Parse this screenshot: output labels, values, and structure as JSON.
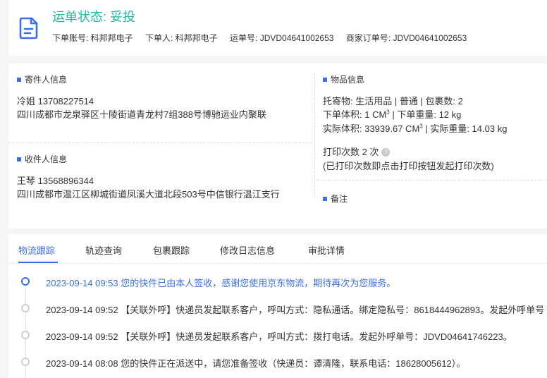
{
  "header": {
    "status_title": "运单状态: 妥投",
    "account": "下单账号: 科邦邦电子",
    "orderer": "下单人: 科邦邦电子",
    "waybill": "运单号: JDVD04641002653",
    "merchant_order": "商家订单号: JDVD04641002653"
  },
  "sender": {
    "title": "寄件人信息",
    "name_phone": "冷姐   13708227514",
    "address": "四川成都市龙泉驿区十陵街道青龙村7组388号博驰运业内聚联"
  },
  "receiver": {
    "title": "收件人信息",
    "name_phone": "王琴   13568896344",
    "address": "四川成都市温江区柳城街道凤溪大道北段503号中信银行温江支行"
  },
  "goods": {
    "title": "物品信息",
    "line1": "托寄物:  生活用品 | 普通  |  包裹数:  2",
    "vol_label": "下单体积:   1 CM",
    "vol_sup": "3",
    "weight": " |  下单重量:   12 kg",
    "actual_vol": "实际体积:   33939.67 CM",
    "actual_sup": "3",
    "actual_weight": " |  实际重量:   14.03 kg",
    "print_count": "打印次数    2 次",
    "print_hint": "(已打印次数即点击打印按钮发起打印次数)"
  },
  "remark": {
    "title": "备注"
  },
  "tabs": [
    "物流跟踪",
    "轨迹查询",
    "包裹跟踪",
    "修改日志信息",
    "审批详情"
  ],
  "timeline": [
    "2023-09-14 09:53  您的快件已由本人签收，感谢您使用京东物流，期待再次为您服务。",
    "2023-09-14 09:52  【关联外呼】快递员发起联系客户，呼叫方式：隐私通话。绑定隐私号：8618444962893。发起外呼单号",
    "2023-09-14 09:52  【关联外呼】快递员发起联系客户，呼叫方式：拨打电话。发起外呼单号：JDVD04641746223。",
    "2023-09-14 08:08  您的快件正在派送中，请您准备签收（快递员：谭清隆，联系电话：18628005612）。"
  ],
  "colors": {
    "accent": "#3a6fe8",
    "status": "#23b7a2"
  }
}
